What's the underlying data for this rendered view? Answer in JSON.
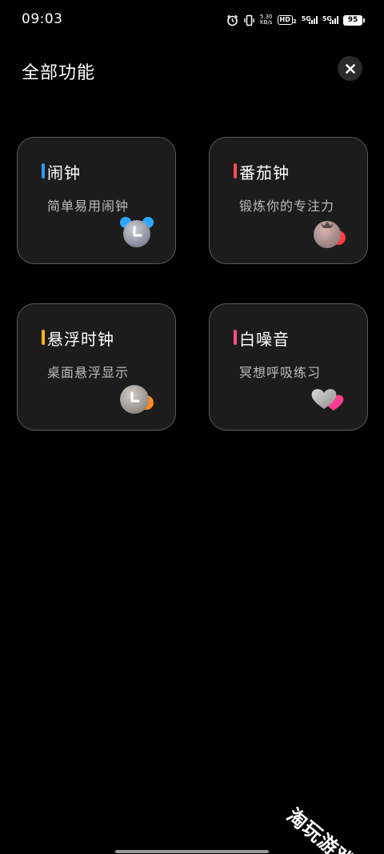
{
  "status_bar": {
    "time": "09:03",
    "net_speed_value": "5.30",
    "net_speed_unit": "KB/s",
    "hd_label": "HD",
    "hd_sub": "2",
    "net_type_1": "5G",
    "net_type_2": "5G",
    "battery": "95",
    "icons": [
      "alarm-icon",
      "vibrate-icon",
      "signal-icon",
      "signal-icon",
      "battery-icon"
    ]
  },
  "header": {
    "title": "全部功能",
    "close_icon": "close-icon"
  },
  "cards": [
    {
      "title": "闹钟",
      "subtitle": "简单易用闹钟",
      "accent": "#2f9bff",
      "icon": "alarm-clock-icon"
    },
    {
      "title": "番茄钟",
      "subtitle": "锻炼你的专注力",
      "accent": "#ff4d4f",
      "icon": "tomato-icon"
    },
    {
      "title": "悬浮时钟",
      "subtitle": "桌面悬浮显示",
      "accent": "#ffb020",
      "icon": "floating-clock-icon"
    },
    {
      "title": "白噪音",
      "subtitle": "冥想呼吸练习",
      "accent": "#ff4d8d",
      "icon": "heart-icon"
    }
  ],
  "watermark": "淘玩游戏"
}
